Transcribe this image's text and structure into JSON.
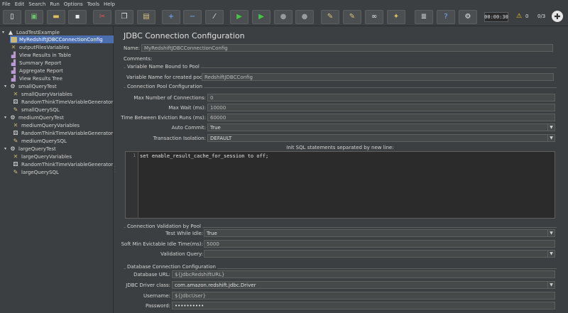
{
  "menu": [
    "File",
    "Edit",
    "Search",
    "Run",
    "Options",
    "Tools",
    "Help"
  ],
  "toolbar": {
    "timer": "00:00:30",
    "warnings": "0",
    "threads": "0/3"
  },
  "tree": {
    "root": "LoadTestExample",
    "items": [
      {
        "label": "MyRedshiftJDBCConnectionConfig",
        "icon": "config-icon",
        "selected": true
      },
      {
        "label": "outputFilesVariables",
        "icon": "variables-icon"
      },
      {
        "label": "View Results in Table",
        "icon": "chart-icon"
      },
      {
        "label": "Summary Report",
        "icon": "chart-icon"
      },
      {
        "label": "Aggregate Report",
        "icon": "chart-icon"
      },
      {
        "label": "View Results Tree",
        "icon": "chart-icon"
      }
    ],
    "groups": [
      {
        "label": "smallQueryTest",
        "children": [
          "smallQueryVariables",
          "RandomThinkTimeVariableGenerator",
          "smallQuerySQL"
        ]
      },
      {
        "label": "mediumQueryTest",
        "children": [
          "mediumQueryVariables",
          "RandomThinkTimeVariableGenerator",
          "mediumQuerySQL"
        ]
      },
      {
        "label": "largeQueryTest",
        "children": [
          "largeQueryVariables",
          "RandomThinkTimeVariableGenerator",
          "largeQuerySQL"
        ]
      }
    ]
  },
  "panel": {
    "title": "JDBC Connection Configuration",
    "name_label": "Name:",
    "name_value": "MyRedshiftJDBCConnectionConfig",
    "comments_label": "Comments:",
    "pool_bound": {
      "title": "Variable Name Bound to Pool",
      "label": "Variable Name for created pool:",
      "value": "RedshiftJDBCConfig"
    },
    "pool_config": {
      "title": "Connection Pool Configuration",
      "max_conn_label": "Max Number of Connections:",
      "max_conn_value": "0",
      "max_wait_label": "Max Wait (ms):",
      "max_wait_value": "10000",
      "eviction_label": "Time Between Eviction Runs (ms):",
      "eviction_value": "60000",
      "auto_commit_label": "Auto Commit:",
      "auto_commit_value": "True",
      "isolation_label": "Transaction Isolation:",
      "isolation_value": "DEFAULT",
      "init_sql_label": "Init SQL statements separated by new line:",
      "sql_line_number": "1",
      "sql_text": "set enable_result_cache_for_session to off;"
    },
    "validation": {
      "title": "Connection Validation by Pool",
      "test_idle_label": "Test While Idle:",
      "test_idle_value": "True",
      "soft_min_label": "Soft Min Evictable Idle Time(ms):",
      "soft_min_value": "5000",
      "query_label": "Validation Query:",
      "query_value": ""
    },
    "db": {
      "title": "Database Connection Configuration",
      "url_label": "Database URL:",
      "url_value": "${JdbcRedshiftURL}",
      "driver_label": "JDBC Driver class:",
      "driver_value": "com.amazon.redshift.jdbc.Driver",
      "user_label": "Username:",
      "user_value": "${JdbcUser}",
      "pass_label": "Password:",
      "pass_value": "••••••••••"
    }
  }
}
